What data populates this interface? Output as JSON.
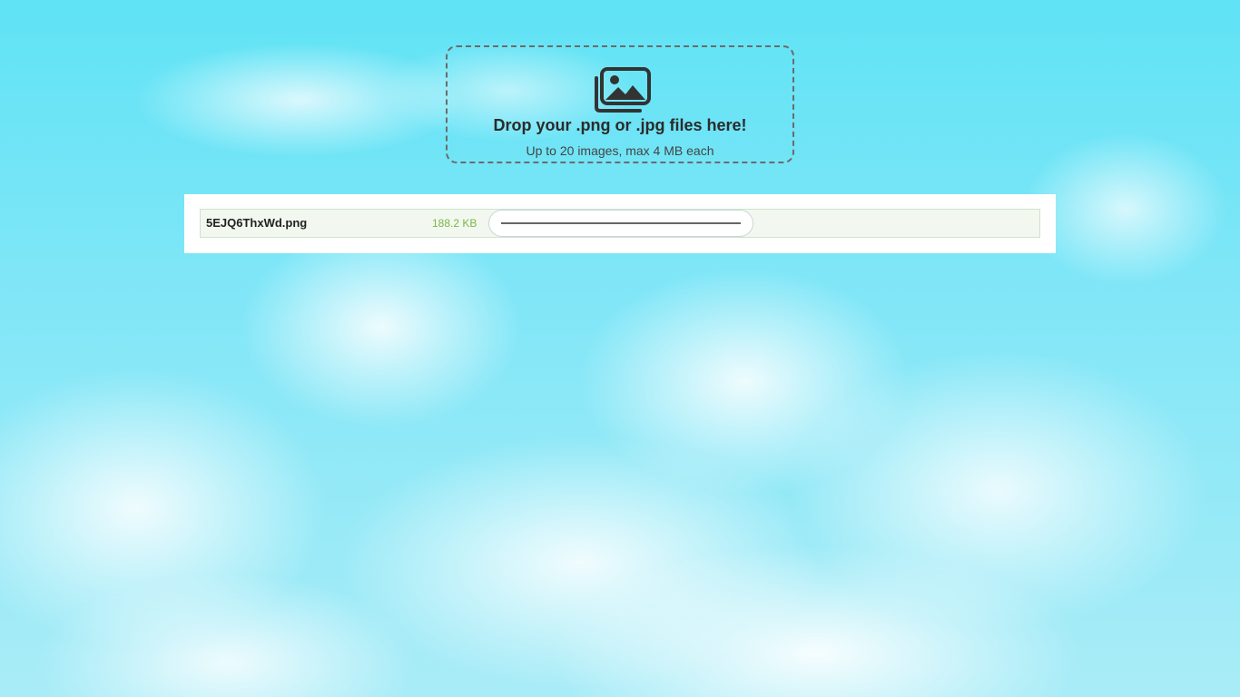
{
  "dropzone": {
    "icon": "images-icon",
    "title": "Drop your .png or .jpg files here!",
    "subtitle": "Up to 20 images, max 4 MB each",
    "border_color": "#6b6b6b"
  },
  "files": [
    {
      "name": "5EJQ6ThxWd.png",
      "size": "188.2 KB",
      "progress": 1.0
    }
  ],
  "colors": {
    "row_background": "#f2f8ef",
    "size_text": "#7ab648",
    "progress_bar": "#666666"
  }
}
